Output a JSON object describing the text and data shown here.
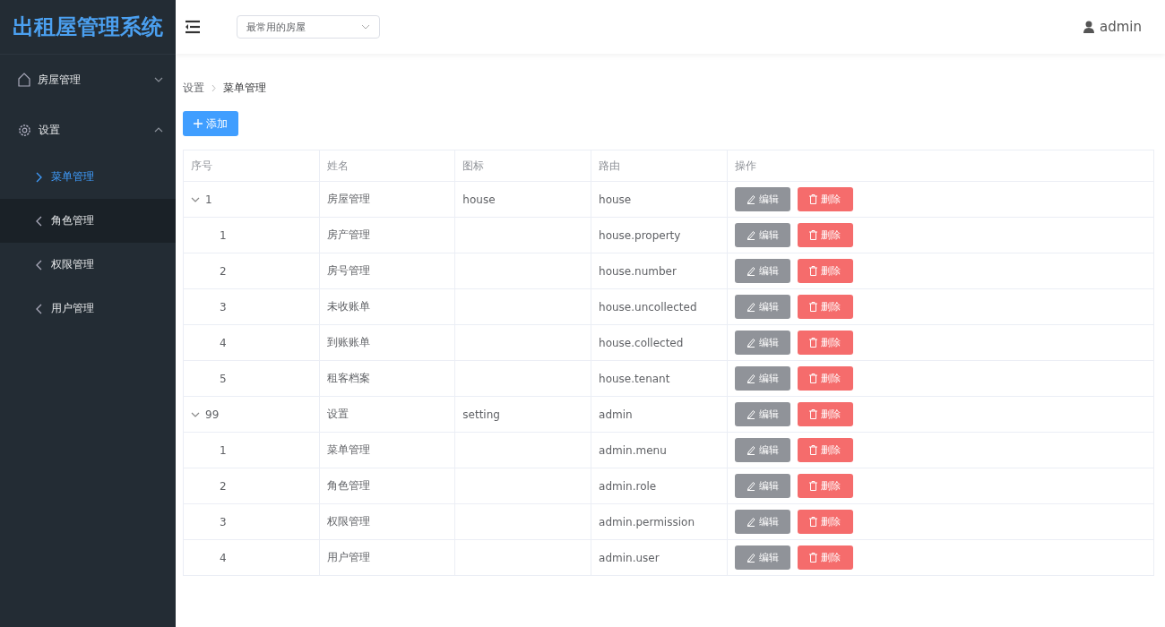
{
  "app_title": "出租屋管理系统",
  "sidebar": {
    "items": [
      {
        "label": "房屋管理",
        "kind": "house",
        "expanded": false
      },
      {
        "label": "设置",
        "kind": "settings",
        "expanded": true,
        "children": [
          {
            "label": "菜单管理",
            "selected": true,
            "hovered": false
          },
          {
            "label": "角色管理",
            "selected": false,
            "hovered": true
          },
          {
            "label": "权限管理",
            "selected": false,
            "hovered": false
          },
          {
            "label": "用户管理",
            "selected": false,
            "hovered": false
          }
        ]
      }
    ]
  },
  "header": {
    "house_select": {
      "value": "最常用的房屋"
    },
    "user": "admin"
  },
  "breadcrumb": [
    "设置",
    "菜单管理"
  ],
  "add_button": "添加",
  "table": {
    "columns": [
      "序号",
      "姓名",
      "图标",
      "路由",
      "操作"
    ],
    "rows": [
      {
        "index": "1",
        "name": "房屋管理",
        "icon_text": "house",
        "route": "house",
        "edit": "编辑",
        "delete": "删除",
        "expanded": true,
        "children": [
          {
            "index": "1",
            "name": "房产管理",
            "route": "house.property",
            "edit": "编辑",
            "delete": "删除"
          },
          {
            "index": "2",
            "name": "房号管理",
            "route": "house.number",
            "edit": "编辑",
            "delete": "删除"
          },
          {
            "index": "3",
            "name": "未收账单",
            "route": "house.uncollected",
            "edit": "编辑",
            "delete": "删除"
          },
          {
            "index": "4",
            "name": "到账账单",
            "route": "house.collected",
            "edit": "编辑",
            "delete": "删除"
          },
          {
            "index": "5",
            "name": "租客档案",
            "route": "house.tenant",
            "edit": "编辑",
            "delete": "删除"
          }
        ]
      },
      {
        "index": "99",
        "name": "设置",
        "icon_text": "setting",
        "route": "admin",
        "edit": "编辑",
        "delete": "删除",
        "expanded": true,
        "children": [
          {
            "index": "1",
            "name": "菜单管理",
            "route": "admin.menu",
            "edit": "编辑",
            "delete": "删除"
          },
          {
            "index": "2",
            "name": "角色管理",
            "route": "admin.role",
            "edit": "编辑",
            "delete": "删除"
          },
          {
            "index": "3",
            "name": "权限管理",
            "route": "admin.permission",
            "edit": "编辑",
            "delete": "删除"
          },
          {
            "index": "4",
            "name": "用户管理",
            "route": "admin.user",
            "edit": "编辑",
            "delete": "删除"
          }
        ]
      }
    ]
  }
}
